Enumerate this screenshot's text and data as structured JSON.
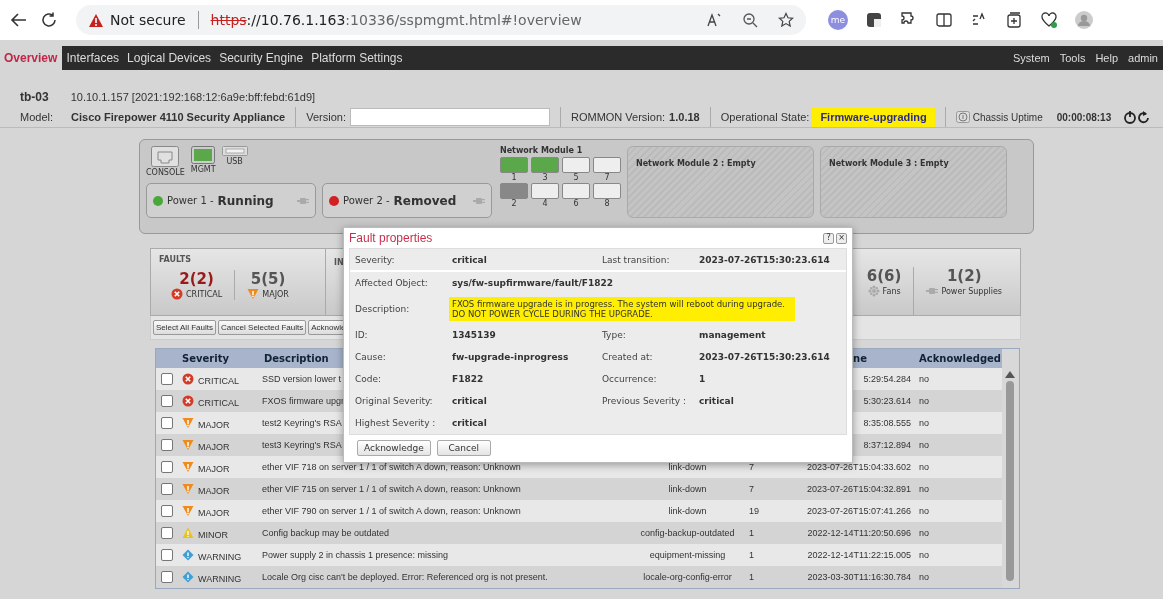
{
  "browser": {
    "security_label": "Not secure",
    "url_scheme": "https",
    "url_host": "://10.76.1.163",
    "url_path": ":10336/sspmgmt.html#!overview",
    "profile_label": "me"
  },
  "nav": {
    "tabs": [
      {
        "label": "Overview",
        "selected": true
      },
      {
        "label": "Interfaces",
        "selected": false
      },
      {
        "label": "Logical Devices",
        "selected": false
      },
      {
        "label": "Security Engine",
        "selected": false
      },
      {
        "label": "Platform Settings",
        "selected": false
      }
    ],
    "right_menu": [
      "System",
      "Tools",
      "Help",
      "admin"
    ]
  },
  "device": {
    "name": "tb-03",
    "address": "10.10.1.157 [2021:192:168:12:6a9e:bff:febd:61d9]",
    "model_label": "Model:",
    "model": "Cisco Firepower 4110 Security Appliance",
    "version_label": "Version:",
    "rommon_label": "ROMMON Version:",
    "rommon": "1.0.18",
    "state_label": "Operational State:",
    "state": "Firmware-upgrading",
    "state_highlight": true,
    "uptime_label": "Chassis Uptime",
    "uptime": "00:00:08:13"
  },
  "chassis": {
    "ports": [
      {
        "label": "CONSOLE",
        "kind": "console"
      },
      {
        "label": "MGMT",
        "kind": "mgmt"
      },
      {
        "label": "USB",
        "kind": "usb"
      }
    ],
    "power": [
      {
        "label": "Power 1 -",
        "status": "Running",
        "color": "#4aa83a"
      },
      {
        "label": "Power 2 -",
        "status": "Removed",
        "color": "#d42020"
      }
    ],
    "network_modules": [
      {
        "title": "Network Module 1",
        "ports": [
          {
            "label": "1",
            "installed": true,
            "active": true
          },
          {
            "label": "2",
            "installed": true,
            "active": false
          },
          {
            "label": "3",
            "installed": true,
            "active": true
          },
          {
            "label": "4",
            "installed": false
          },
          {
            "label": "5",
            "installed": false
          },
          {
            "label": "6",
            "installed": false
          },
          {
            "label": "7",
            "installed": false
          },
          {
            "label": "8",
            "installed": false
          }
        ]
      },
      {
        "title": "Network Module 2 : Empty"
      },
      {
        "title": "Network Module 3 : Empty"
      }
    ]
  },
  "faults": {
    "title": "FAULTS",
    "counts": [
      {
        "value": "2(2)",
        "label": "CRITICAL",
        "kind": "critical"
      },
      {
        "value": "5(5)",
        "label": "MAJOR",
        "kind": "major"
      }
    ],
    "next_title": "IN",
    "extra_counts": [
      {
        "value": "6(6)",
        "label": "Fans",
        "kind": "fans"
      },
      {
        "value": "1(2)",
        "label": "Power Supplies",
        "kind": "power"
      }
    ],
    "actions": [
      "Select All Faults",
      "Cancel Selected Faults",
      "Acknowle"
    ]
  },
  "table": {
    "columns": [
      "Severity",
      "Description",
      "ne",
      "Acknowledged"
    ],
    "rows": [
      {
        "checked": false,
        "kind": "critical",
        "severity": "CRITICAL",
        "description": "SSD version lower t",
        "time": "5:29:54.284",
        "acknowledged": "no"
      },
      {
        "checked": false,
        "kind": "critical",
        "severity": "CRITICAL",
        "description": "FXOS firmware upgr",
        "time": "5:30:23.614",
        "acknowledged": "no"
      },
      {
        "checked": false,
        "kind": "major",
        "severity": "MAJOR",
        "description": "test2 Keyring's RSA",
        "time": "8:35:08.555",
        "acknowledged": "no"
      },
      {
        "checked": false,
        "kind": "major",
        "severity": "MAJOR",
        "description": "test3 Keyring's RSA",
        "time": "8:37:12.894",
        "acknowledged": "no"
      },
      {
        "checked": false,
        "kind": "major",
        "severity": "MAJOR",
        "description": "ether VIF 718 on server 1 / 1 of switch A down, reason: Unknown",
        "cause": "link-down",
        "occurrence": "7",
        "time": "2023-07-26T15:04:33.602",
        "acknowledged": "no"
      },
      {
        "checked": false,
        "kind": "major",
        "severity": "MAJOR",
        "description": "ether VIF 715 on server 1 / 1 of switch A down, reason: Unknown",
        "cause": "link-down",
        "occurrence": "7",
        "time": "2023-07-26T15:04:32.891",
        "acknowledged": "no"
      },
      {
        "checked": false,
        "kind": "major",
        "severity": "MAJOR",
        "description": "ether VIF 790 on server 1 / 1 of switch A down, reason: Unknown",
        "cause": "link-down",
        "occurrence": "19",
        "time": "2023-07-26T15:07:41.266",
        "acknowledged": "no"
      },
      {
        "checked": false,
        "kind": "minor",
        "severity": "MINOR",
        "description": "Config backup may be outdated",
        "cause": "config-backup-outdated",
        "occurrence": "1",
        "time": "2022-12-14T11:20:50.696",
        "acknowledged": "no"
      },
      {
        "checked": false,
        "kind": "warning",
        "severity": "WARNING",
        "description": "Power supply 2 in chassis 1 presence: missing",
        "cause": "equipment-missing",
        "occurrence": "1",
        "time": "2022-12-14T11:22:15.005",
        "acknowledged": "no"
      },
      {
        "checked": false,
        "kind": "warning",
        "severity": "WARNING",
        "description": "Locale Org cisc can't be deployed. Error: Referenced org is not present.",
        "cause": "locale-org-config-error",
        "occurrence": "1",
        "time": "2023-03-30T11:16:30.784",
        "acknowledged": "no"
      }
    ]
  },
  "dialog": {
    "title": "Fault properties",
    "help_label": "?",
    "close_label": "×",
    "rows": [
      [
        {
          "label": "Severity:",
          "value": "critical"
        },
        {
          "label": "Last transition:",
          "value": "2023-07-26T15:30:23.614"
        }
      ],
      [
        {
          "label": "Affected Object:",
          "value": "sys/fw-supfirmware/fault/F1822"
        }
      ],
      [
        {
          "label": "Description:",
          "value": "FXOS firmware upgrade is in progress. The system will reboot during upgrade. DO NOT POWER CYCLE DURING THE UPGRADE.",
          "highlight": true
        }
      ],
      [
        {
          "label": "ID:",
          "value": "1345139"
        },
        {
          "label": "Type:",
          "value": "management"
        }
      ],
      [
        {
          "label": "Cause:",
          "value": "fw-upgrade-inprogress"
        },
        {
          "label": "Created at:",
          "value": "2023-07-26T15:30:23.614"
        }
      ],
      [
        {
          "label": "Code:",
          "value": "F1822"
        },
        {
          "label": "Occurrence:",
          "value": "1"
        }
      ],
      [
        {
          "label": "Original Severity:",
          "value": "critical"
        },
        {
          "label": "Previous Severity :",
          "value": "critical"
        }
      ],
      [
        {
          "label": "Highest Severity :",
          "value": "critical"
        }
      ]
    ],
    "buttons": [
      "Acknowledge",
      "Cancel"
    ]
  }
}
